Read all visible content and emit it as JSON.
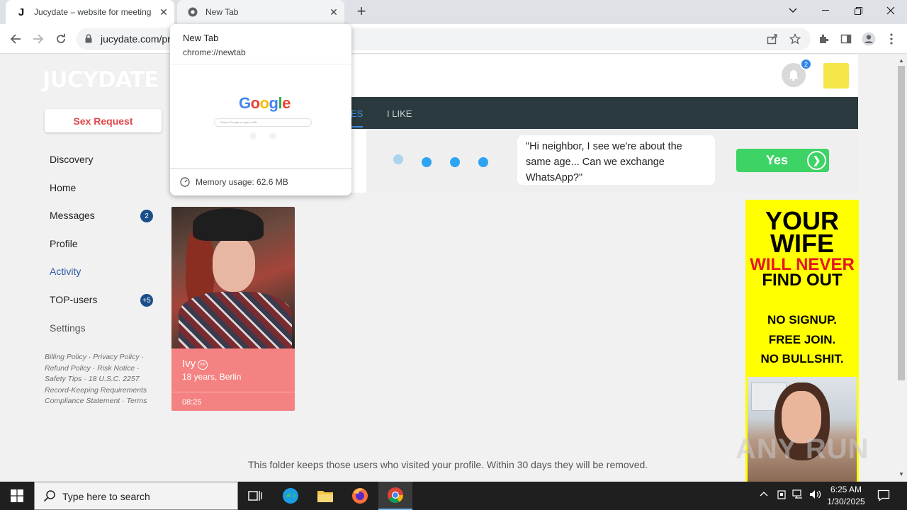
{
  "browser": {
    "tabs": [
      {
        "title": "Jucydate – website for meeting",
        "active": true
      },
      {
        "title": "New Tab",
        "active": false
      }
    ],
    "url": "jucydate.com/pr",
    "hover_card": {
      "title": "New Tab",
      "url": "chrome://newtab",
      "preview_logo": "Google",
      "preview_search_placeholder": "Search Google or type a URL",
      "memory": "Memory usage: 62.6 MB"
    }
  },
  "site": {
    "logo": "JUCYDATE",
    "sex_request_label": "Sex Request",
    "nav": [
      {
        "label": "Discovery"
      },
      {
        "label": "Home"
      },
      {
        "label": "Messages",
        "badge": "2"
      },
      {
        "label": "Profile"
      },
      {
        "label": "Activity"
      },
      {
        "label": "TOP-users",
        "badge": "+5"
      },
      {
        "label": "Settings"
      }
    ],
    "footer_links": "Billing Policy · Privacy Policy · Refund Policy · Risk Notice · Safety Tips · 18 U.S.C. 2257 Record-Keeping Requirements Compliance Statement · Terms",
    "notification_count": "2",
    "tabs": [
      {
        "label": "ES",
        "selected": true
      },
      {
        "label": "I LIKE",
        "selected": false
      }
    ],
    "chat_fragment": ")",
    "chat_message": "\"Hi neighbor, I see we're about the same age... Can we exchange WhatsApp?\"",
    "yes_label": "Yes",
    "yes_arrow": "❯",
    "profile_card": {
      "name": "Ivy",
      "vip_label": "VIP",
      "details": "18 years, Berlin",
      "time": "08:25"
    },
    "folder_note": "This folder keeps those users who visited your profile. Within 30 days they will be removed.",
    "ad": {
      "line1": "YOUR",
      "line2": "WIFE",
      "line3": "WILL NEVER",
      "line4": "FIND OUT",
      "line5": "NO SIGNUP.",
      "line6": "FREE JOIN.",
      "line7": "NO BULLSHIT."
    },
    "watermark": "ANY RUN"
  },
  "taskbar": {
    "search_placeholder": "Type here to search",
    "time": "6:25 AM",
    "date": "1/30/2025"
  },
  "colors": {
    "accent_red": "#e0474c",
    "yes_green": "#3dd365",
    "tabs_bar": "#2b3a3f",
    "card_pink": "#f58282",
    "ad_yellow": "#ffff00"
  }
}
